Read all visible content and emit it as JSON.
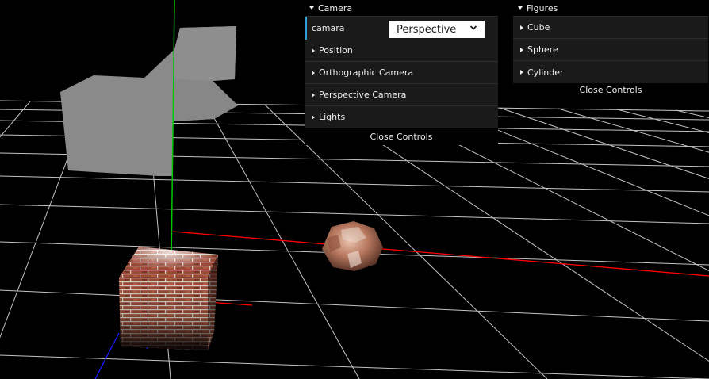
{
  "camera_panel": {
    "title": "Camera",
    "camara_label": "camara",
    "camara_value": "Perspective",
    "folders": [
      "Position",
      "Orthographic Camera",
      "Perspective Camera",
      "Lights"
    ],
    "close_label": "Close Controls"
  },
  "figures_panel": {
    "title": "Figures",
    "folders": [
      "Cube",
      "Sphere",
      "Cylinder"
    ],
    "close_label": "Close Controls"
  },
  "colors": {
    "accent": "#2fa1d6",
    "panel_bg": "#1a1a1a",
    "grid": "#cfcfcf",
    "x_axis": "#ff0000",
    "y_axis": "#00cc00",
    "z_axis": "#1a1aff"
  }
}
